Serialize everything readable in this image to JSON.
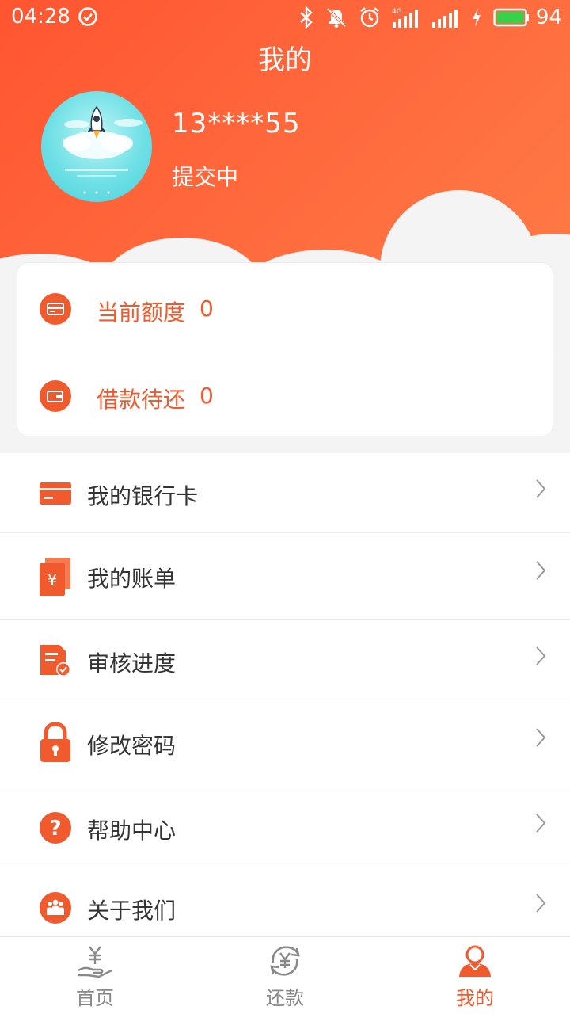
{
  "status_bar": {
    "time": "04:28",
    "battery": "94"
  },
  "header": {
    "title": "我的",
    "phone": "13****55",
    "status": "提交中"
  },
  "summary": {
    "credit_label": "当前额度",
    "credit_value": "0",
    "loan_label": "借款待还",
    "loan_value": "0"
  },
  "menu": [
    {
      "label": "我的银行卡",
      "icon": "bank-card-icon"
    },
    {
      "label": "我的账单",
      "icon": "bill-icon"
    },
    {
      "label": "审核进度",
      "icon": "review-progress-icon"
    },
    {
      "label": "修改密码",
      "icon": "lock-icon"
    },
    {
      "label": "帮助中心",
      "icon": "help-icon"
    },
    {
      "label": "关于我们",
      "icon": "about-us-icon"
    }
  ],
  "bottom_nav": [
    {
      "label": "首页",
      "icon": "home-yuan-hand-icon",
      "active": false
    },
    {
      "label": "还款",
      "icon": "repay-cycle-icon",
      "active": false
    },
    {
      "label": "我的",
      "icon": "profile-icon",
      "active": true
    }
  ],
  "colors": {
    "accent": "#f05a2d",
    "header_gradient_start": "#ff5530",
    "header_gradient_end": "#ff7b46",
    "avatar_bg": "#4ccfd8"
  }
}
